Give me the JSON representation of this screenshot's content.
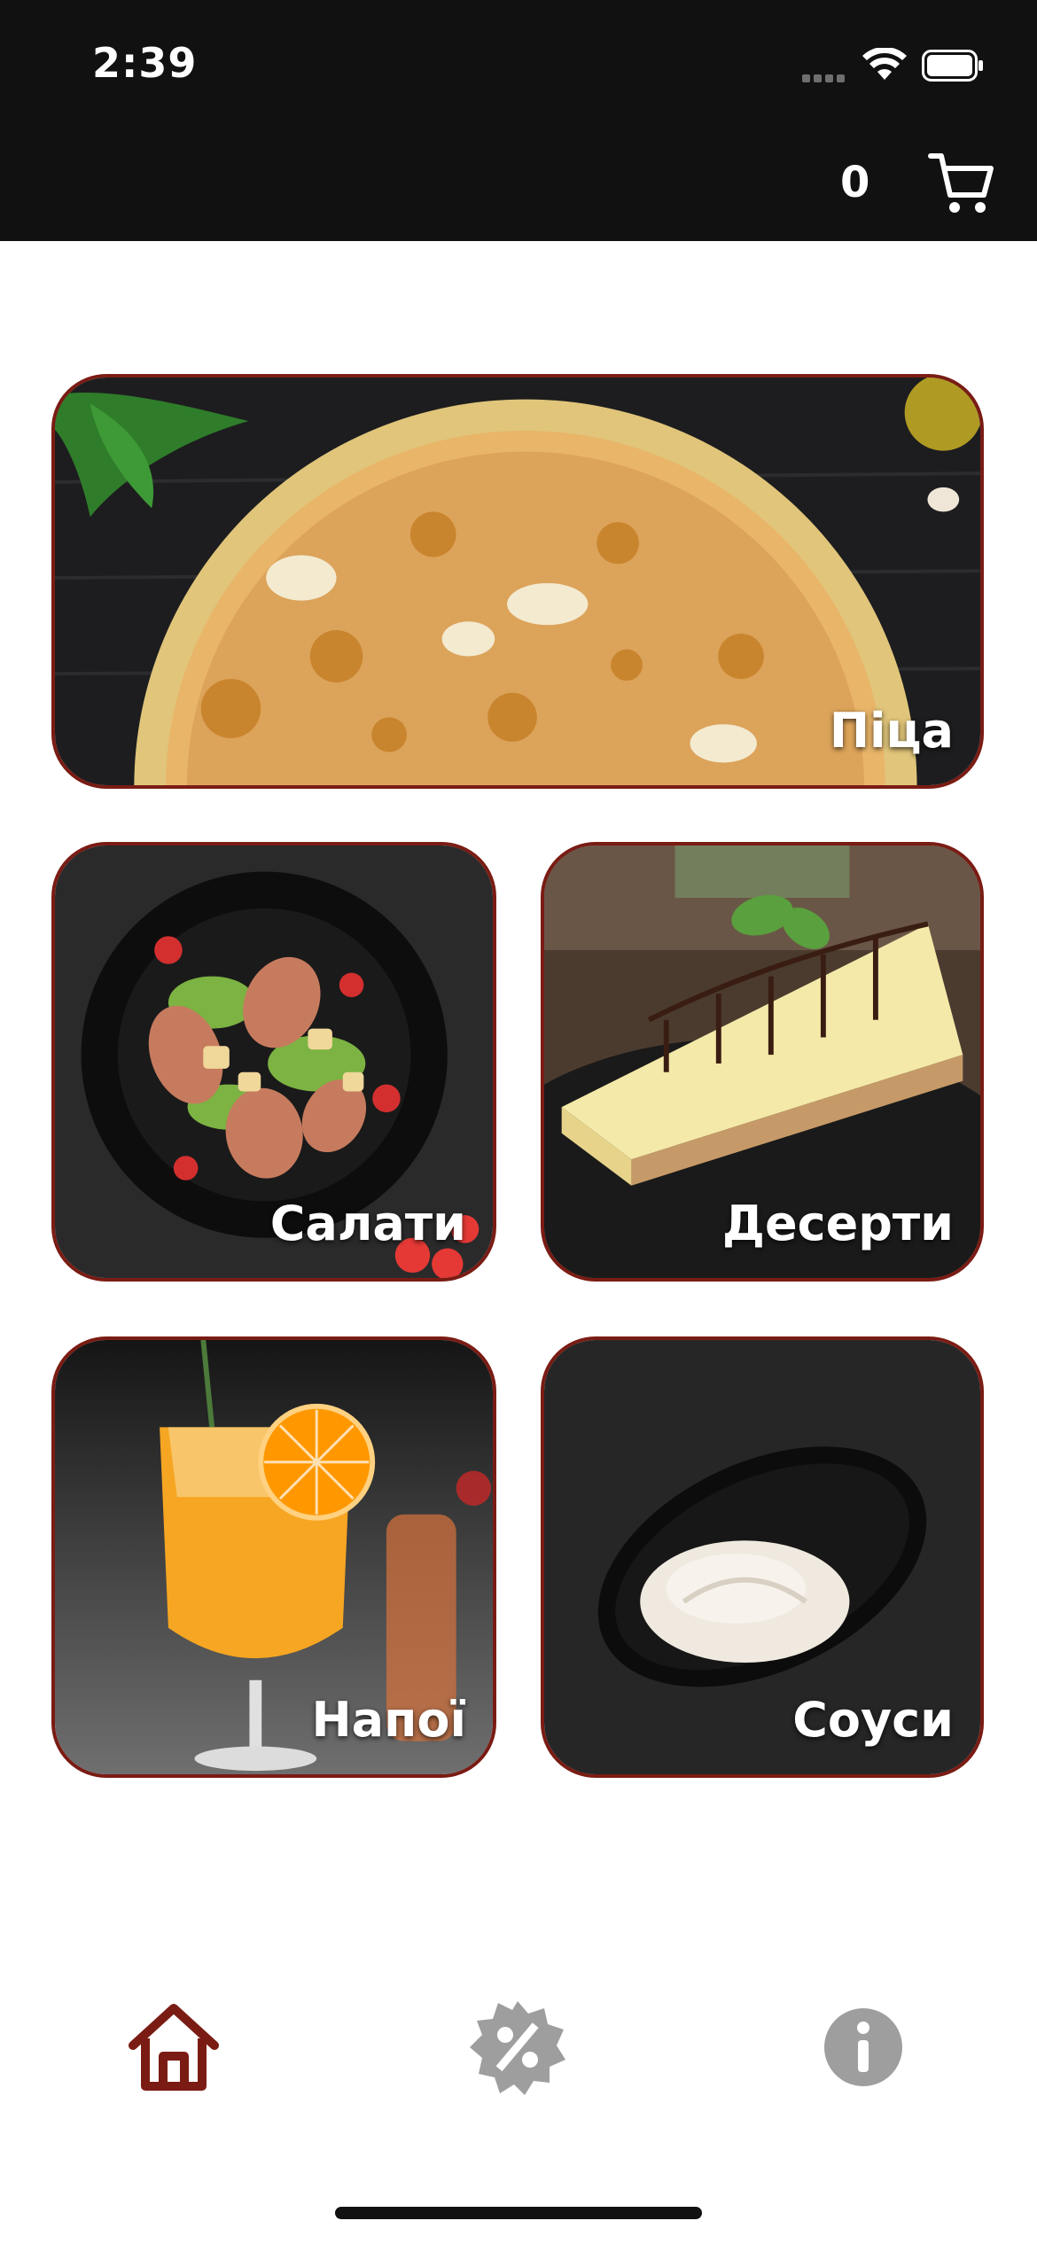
{
  "status_bar": {
    "time": "2:39"
  },
  "header": {
    "cart_count": "0",
    "cart_icon": "cart-icon"
  },
  "categories": [
    {
      "id": "pizza",
      "label": "Піца"
    },
    {
      "id": "salads",
      "label": "Салати"
    },
    {
      "id": "desserts",
      "label": "Десерти"
    },
    {
      "id": "drinks",
      "label": "Напої"
    },
    {
      "id": "sauces",
      "label": "Соуси"
    }
  ],
  "tabs": [
    {
      "id": "home",
      "icon": "home-icon",
      "active": true
    },
    {
      "id": "promotions",
      "icon": "discount-badge-icon",
      "active": false
    },
    {
      "id": "info",
      "icon": "info-icon",
      "active": false
    }
  ],
  "colors": {
    "accent": "#7a1c14",
    "inactive_icon": "#9e9e9e",
    "header_bg": "#111111"
  }
}
